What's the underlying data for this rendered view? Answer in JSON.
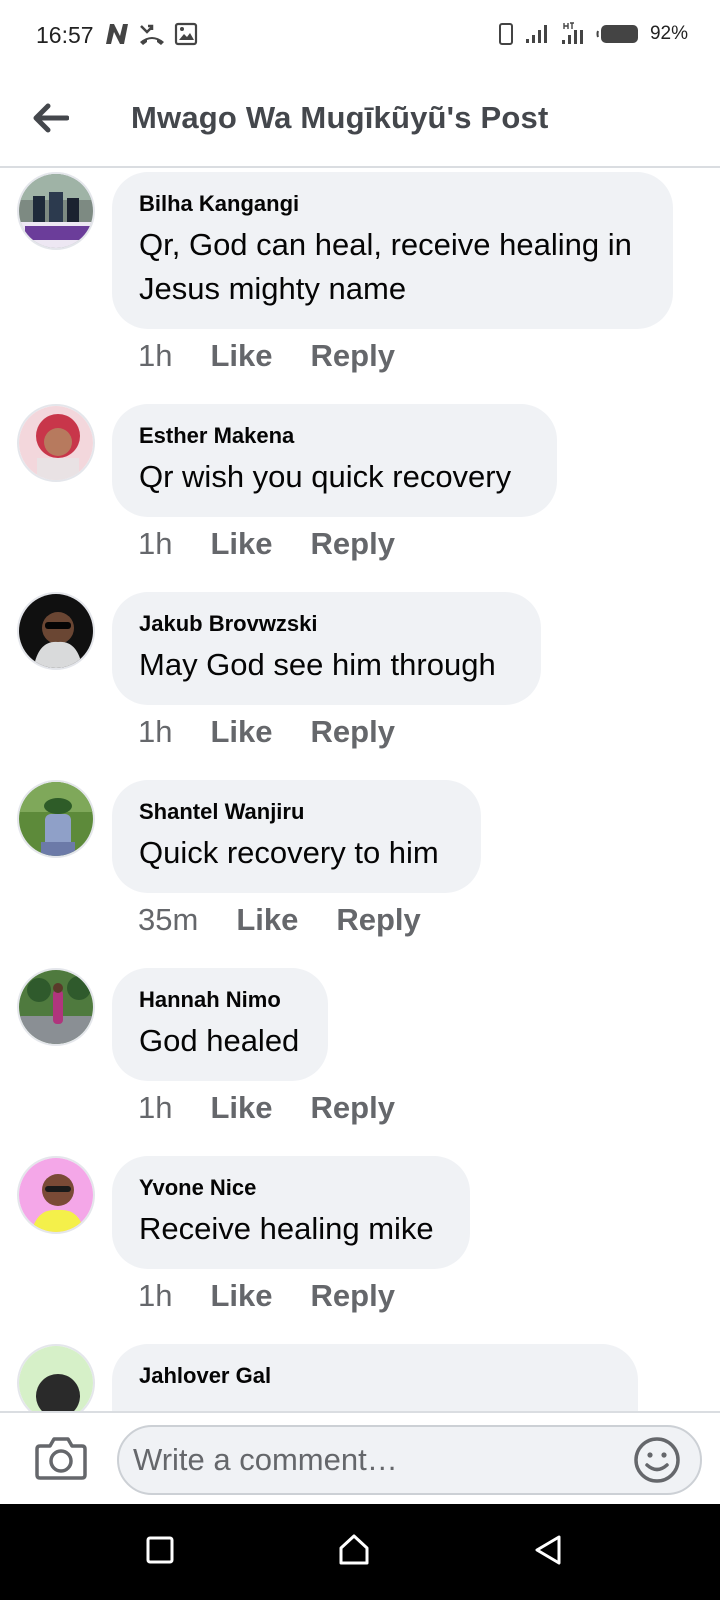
{
  "status_bar": {
    "time": "16:57",
    "battery": "92%"
  },
  "header": {
    "title": "Mwago Wa Mugīkũyũ's Post"
  },
  "comments": [
    {
      "author": "Bilha Kangangi",
      "text": "Qr, God can heal, receive healing in Jesus mighty name",
      "time": "1h",
      "like": "Like",
      "reply": "Reply"
    },
    {
      "author": "Esther Makena",
      "text": "Qr wish you quick recovery",
      "time": "1h",
      "like": "Like",
      "reply": "Reply"
    },
    {
      "author": "Jakub Brovwzski",
      "text": "May God see him through",
      "time": "1h",
      "like": "Like",
      "reply": "Reply"
    },
    {
      "author": "Shantel Wanjiru",
      "text": "Quick recovery to him",
      "time": "35m",
      "like": "Like",
      "reply": "Reply"
    },
    {
      "author": "Hannah Nimo",
      "text": "God healed",
      "time": "1h",
      "like": "Like",
      "reply": "Reply"
    },
    {
      "author": "Yvone Nice",
      "text": "Receive healing mike",
      "time": "1h",
      "like": "Like",
      "reply": "Reply"
    },
    {
      "author": "Jahlover Gal",
      "text": "",
      "time": "",
      "like": "",
      "reply": ""
    }
  ],
  "composer": {
    "placeholder": "Write a comment…"
  },
  "icons": {
    "back": "arrow-left-icon",
    "camera": "camera-icon",
    "emoji": "smiley-icon",
    "nav_recents": "square-icon",
    "nav_home": "home-icon",
    "nav_back": "triangle-back-icon"
  },
  "colors": {
    "bubble": "#f0f2f5",
    "secondary_text": "#65676b",
    "title_text": "#44474c"
  }
}
